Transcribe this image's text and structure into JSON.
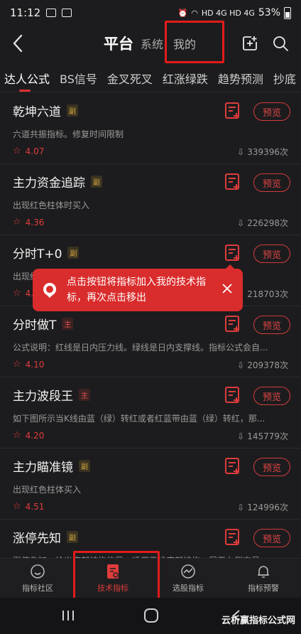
{
  "status_bar": {
    "time": "11:12",
    "network": "HD 4G HD 4G",
    "battery": "53%"
  },
  "header": {
    "title": "平台",
    "tab_system": "系统",
    "tab_mine": "我的"
  },
  "categories": [
    "达人公式",
    "BS信号",
    "金叉死叉",
    "红涨绿跌",
    "趋势预测",
    "抄底"
  ],
  "items": [
    {
      "title": "乾坤六道",
      "tag": "副",
      "desc": "六道共振指标。修复时间限制",
      "rating": "4.07",
      "count": "339396次",
      "preview": "预览"
    },
    {
      "title": "主力资金追踪",
      "tag": "副",
      "desc": "出现红色柱体时买入",
      "rating": "4.36",
      "count": "226298次",
      "preview": "预览"
    },
    {
      "title": "分时T+0",
      "tag": "副",
      "desc": "出现红",
      "rating": "4.",
      "count": "218703次",
      "preview": "预览"
    },
    {
      "title": "分时做T",
      "tag": "主",
      "desc": "公式说明：红线是日内压力线。绿线是日内支撑线。指标公式会自...",
      "rating": "4.10",
      "count": "209378次",
      "preview": "预览"
    },
    {
      "title": "主力波段王",
      "tag": "主",
      "desc": "如下图所示当K线由蓝（绿）转红或者红蓝带由蓝（绿）转红，那...",
      "rating": "4.20",
      "count": "145779次",
      "preview": "预览"
    },
    {
      "title": "主力瞄准镜",
      "tag": "副",
      "desc": "出现红色柱体买入",
      "rating": "4.51",
      "count": "124996次",
      "preview": "预览"
    },
    {
      "title": "涨停先知",
      "tag": "副",
      "desc": "涨停先知：给出底部结构信号，适用于找底部结构，属于右侧交易",
      "rating": "",
      "count": "",
      "preview": "预览"
    }
  ],
  "toast": {
    "text": "点击按钮将指标加入我的技术指标，再次点击移出"
  },
  "bottom_nav": [
    {
      "label": "指标社区",
      "icon": "smile-icon"
    },
    {
      "label": "技术指标",
      "icon": "indicator-doc-icon"
    },
    {
      "label": "选股指标",
      "icon": "chart-circle-icon"
    },
    {
      "label": "指标预警",
      "icon": "bell-icon"
    }
  ],
  "watermark": "云析赢指标公式网",
  "colors": {
    "accent": "#e03c3c",
    "background": "#1c1c1e",
    "highlight_box": "#e31b1b"
  }
}
